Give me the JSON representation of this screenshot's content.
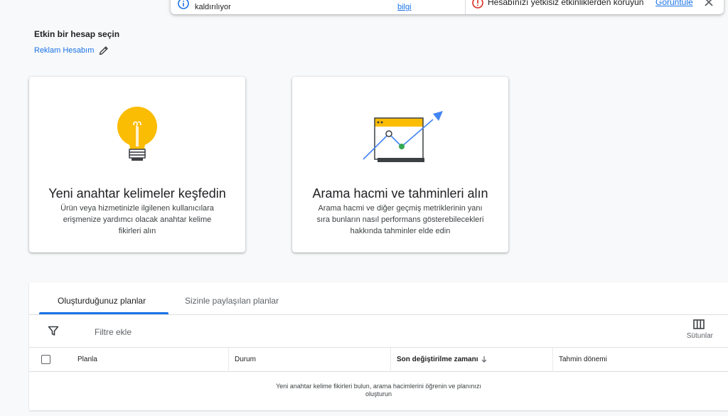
{
  "notification": {
    "text_1": "kaldırılıyor",
    "link_1": "bilgi",
    "text_2": "Hesabınızı yetkisiz etkinliklerden koruyun",
    "link_2": "Görüntüle"
  },
  "account": {
    "heading": "Etkin bir hesap seçin",
    "name": "Reklam Hesabım"
  },
  "cards": [
    {
      "title": "Yeni anahtar kelimeler keşfedin",
      "description": "Ürün veya hizmetinizle ilgilenen kullanıcılara erişmenize yardımcı olacak anahtar kelime fikirleri alın",
      "icon": "lightbulb-icon"
    },
    {
      "title": "Arama hacmi ve tahminleri alın",
      "description": "Arama hacmi ve diğer geçmiş metriklerinin yanı sıra bunların nasıl performans gösterebilecekleri hakkında tahminler elde edin",
      "icon": "trend-chart-icon"
    }
  ],
  "plans": {
    "tabs": [
      "Oluşturduğunuz planlar",
      "Sizinle paylaşılan planlar"
    ],
    "active_tab": 0,
    "filter_label": "Filtre ekle",
    "columns_label": "Sütunlar",
    "headers": [
      "Planla",
      "Durum",
      "Son değiştirilme zamanı",
      "Tahmin dönemi"
    ],
    "sorted_column": "Son değiştirilme zamanı",
    "sort_direction": "descending",
    "empty_message": "Yeni anahtar kelime fikirleri bulun, arama hacimlerini öğrenin ve planınızı oluşturun"
  },
  "colors": {
    "accent": "#1a73e8",
    "bulb_yellow": "#fbbc04",
    "warning_red": "#d93025",
    "chart_green": "#34a853"
  }
}
